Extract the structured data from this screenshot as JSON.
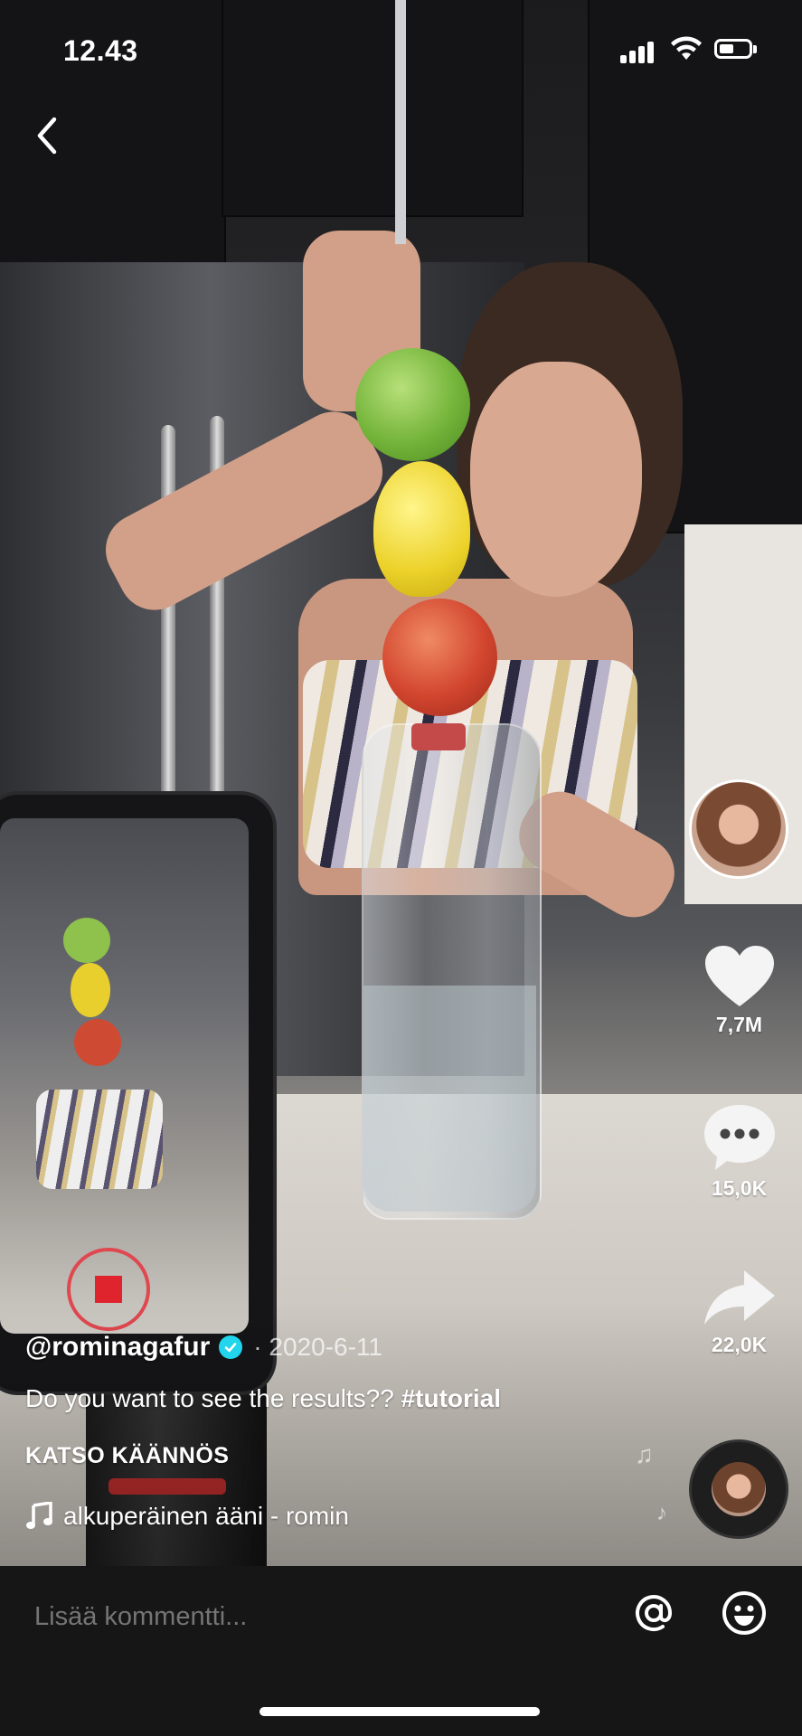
{
  "status_bar": {
    "time": "12.43",
    "signal_icon": "cellular-signal-icon",
    "wifi_icon": "wifi-icon",
    "battery_icon": "battery-icon",
    "battery_level": 0.5
  },
  "nav": {
    "back_icon": "chevron-left-icon"
  },
  "actions": {
    "avatar_icon": "profile-avatar",
    "like": {
      "icon": "heart-icon",
      "count": "7,7M"
    },
    "comments": {
      "icon": "comment-bubble-icon",
      "count": "15,0K"
    },
    "share": {
      "icon": "share-arrow-icon",
      "count": "22,0K"
    }
  },
  "post": {
    "username": "@rominagafur",
    "verified_icon": "verified-badge-icon",
    "date": "· 2020-6-11",
    "caption": "Do you want to see the results?? ",
    "hashtag": "#tutorial",
    "translate_label": "KATSO KÄÄNNÖS",
    "sound_icon": "music-note-icon",
    "sound": "alkuperäinen ääni - romin",
    "disc_icon": "sound-disc-icon"
  },
  "comment_bar": {
    "placeholder": "Lisää kommentti...",
    "mention_icon": "at-sign-icon",
    "emoji_icon": "emoji-smile-icon"
  },
  "colors": {
    "verified": "#20d5ec",
    "comment_bar_bg": "#161616",
    "placeholder": "#8a8a8a"
  }
}
